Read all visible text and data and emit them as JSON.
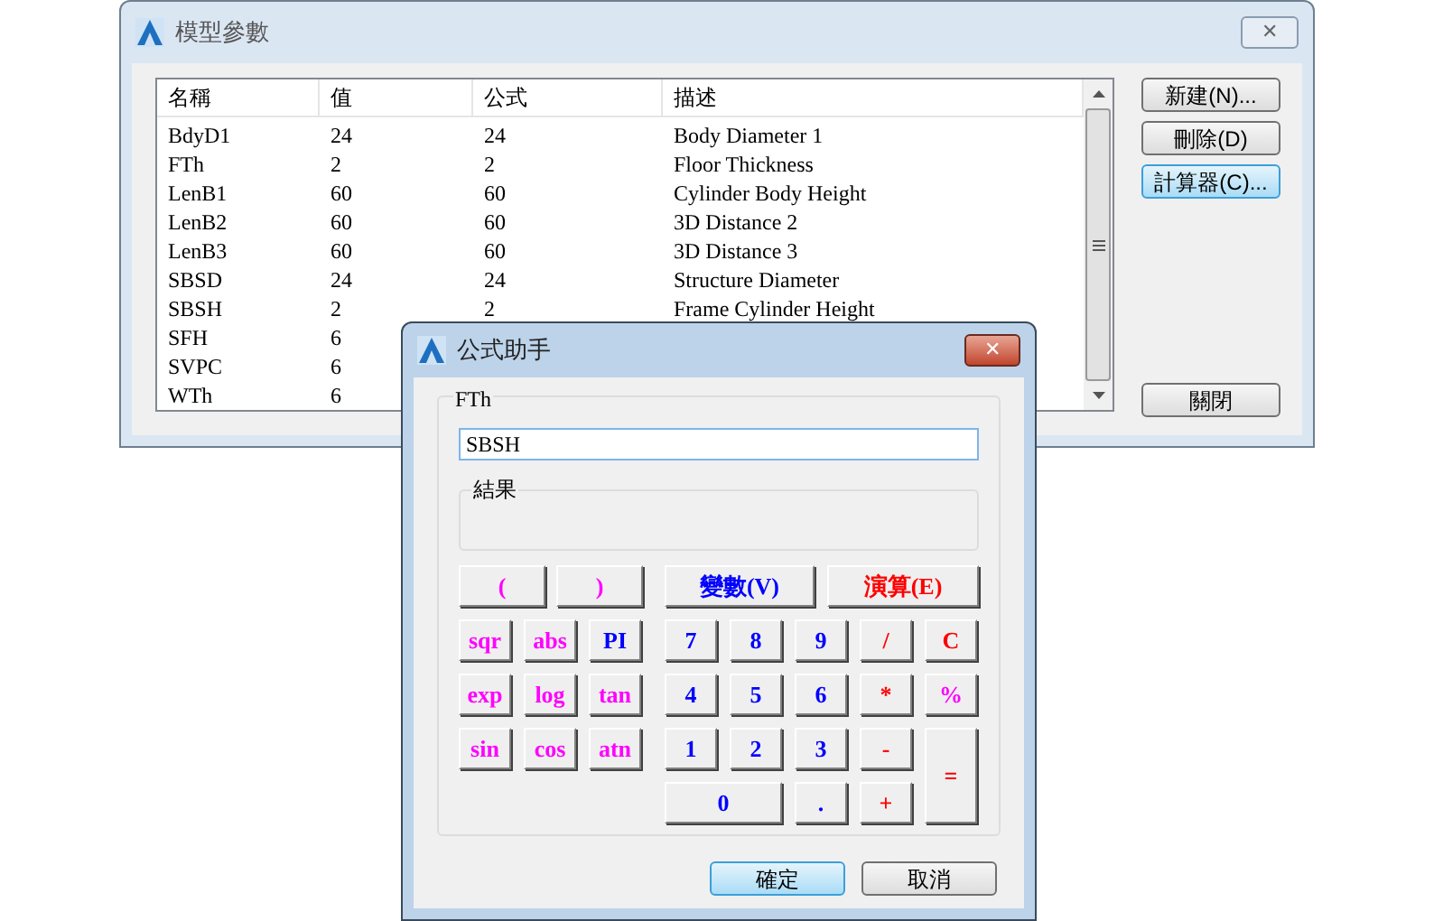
{
  "main_window": {
    "title": "模型參數",
    "close": "✕",
    "table": {
      "columns": [
        "名稱",
        "值",
        "公式",
        "描述"
      ],
      "rows": [
        {
          "cells": [
            "BdyD1",
            "24",
            "24",
            "Body Diameter 1"
          ]
        },
        {
          "cells": [
            "FTh",
            "2",
            "2",
            "Floor Thickness"
          ]
        },
        {
          "cells": [
            "LenB1",
            "60",
            "60",
            "Cylinder Body Height"
          ]
        },
        {
          "cells": [
            "LenB2",
            "60",
            "60",
            "3D Distance 2"
          ]
        },
        {
          "cells": [
            "LenB3",
            "60",
            "60",
            "3D Distance 3"
          ]
        },
        {
          "cells": [
            "SBSD",
            "24",
            "24",
            "Structure Diameter"
          ]
        },
        {
          "cells": [
            "SBSH",
            "2",
            "2",
            "Frame Cylinder Height"
          ]
        },
        {
          "cells": [
            "SFH",
            "6"
          ]
        },
        {
          "cells": [
            "SVPC",
            "6"
          ]
        },
        {
          "cells": [
            "WTh",
            "6"
          ]
        }
      ]
    },
    "buttons": [
      {
        "label": "新建(N)...",
        "focused": false
      },
      {
        "label": "刪除(D)",
        "focused": false
      },
      {
        "label": "計算器(C)...",
        "focused": true
      }
    ],
    "close_button": "關閉"
  },
  "dialog": {
    "title": "公式助手",
    "close": "✕",
    "group_label": "FTh",
    "expression": "SBSH",
    "result_label": "結果",
    "top_keys": [
      {
        "label": "(",
        "color": "#ff00ff"
      },
      {
        "label": ")",
        "color": "#ff00ff"
      },
      {
        "label": "變數(V)",
        "color": "#0000ff"
      },
      {
        "label": "演算(E)",
        "color": "#ff0000"
      }
    ],
    "function_keys": [
      {
        "label": "sqr",
        "color": "#ff00ff"
      },
      {
        "label": "abs",
        "color": "#ff00ff"
      },
      {
        "label": "PI",
        "color": "#0000ff"
      },
      {
        "label": "exp",
        "color": "#ff00ff"
      },
      {
        "label": "log",
        "color": "#ff00ff"
      },
      {
        "label": "tan",
        "color": "#ff00ff"
      },
      {
        "label": "sin",
        "color": "#ff00ff"
      },
      {
        "label": "cos",
        "color": "#ff00ff"
      },
      {
        "label": "atn",
        "color": "#ff00ff"
      }
    ],
    "number_keys": [
      {
        "label": "7",
        "color": "#0000ff",
        "kind": "normal"
      },
      {
        "label": "8",
        "color": "#0000ff",
        "kind": "normal"
      },
      {
        "label": "9",
        "color": "#0000ff",
        "kind": "normal"
      },
      {
        "label": "/",
        "color": "#ff0000",
        "kind": "normal"
      },
      {
        "label": "C",
        "color": "#ff0000",
        "kind": "normal"
      },
      {
        "label": "4",
        "color": "#0000ff",
        "kind": "normal"
      },
      {
        "label": "5",
        "color": "#0000ff",
        "kind": "normal"
      },
      {
        "label": "6",
        "color": "#0000ff",
        "kind": "normal"
      },
      {
        "label": "*",
        "color": "#ff0000",
        "kind": "normal"
      },
      {
        "label": "%",
        "color": "#ff00ff",
        "kind": "normal"
      },
      {
        "label": "1",
        "color": "#0000ff",
        "kind": "normal"
      },
      {
        "label": "2",
        "color": "#0000ff",
        "kind": "normal"
      },
      {
        "label": "3",
        "color": "#0000ff",
        "kind": "normal"
      },
      {
        "label": "-",
        "color": "#ff0000",
        "kind": "normal"
      },
      {
        "label": "=",
        "color": "#ff0000",
        "kind": "tall"
      },
      {
        "label": "0",
        "color": "#0000ff",
        "kind": "wide"
      },
      {
        "label": ".",
        "color": "#0000ff",
        "kind": "normal"
      },
      {
        "label": "+",
        "color": "#ff0000",
        "kind": "normal"
      }
    ],
    "buttons": [
      {
        "label": "確定",
        "focused": true
      },
      {
        "label": "取消",
        "focused": false
      }
    ]
  }
}
